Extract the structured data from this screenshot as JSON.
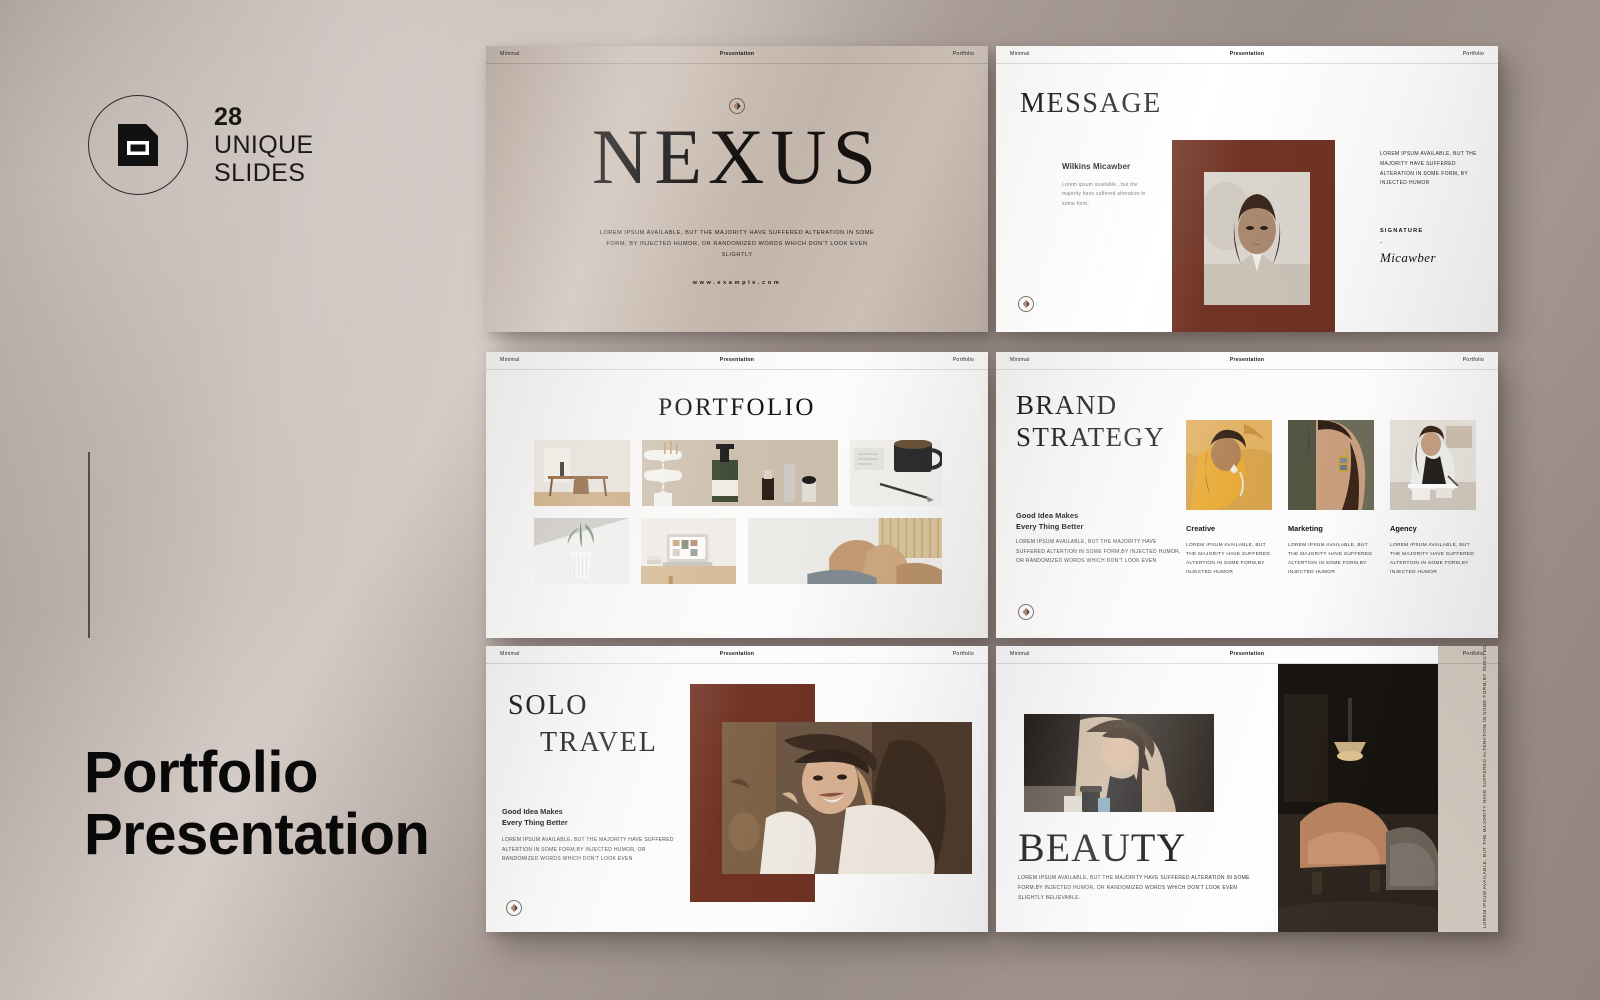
{
  "sidebar": {
    "badge": {
      "icon": "slide-icon",
      "count": "28",
      "line1": "UNIQUE",
      "line2": "SLIDES"
    },
    "main_title_line1": "Portfolio",
    "main_title_line2": "Presentation"
  },
  "colors": {
    "accent_brown": "#6e3020",
    "backdrop": "#a2968f",
    "ink": "#121010",
    "logo_copper": "#b5724a"
  },
  "slide_header": {
    "left": "Minimal",
    "center": "Presentation",
    "right": "Portfolio"
  },
  "slides": [
    {
      "id": "cover",
      "name": "nexus-cover-slide",
      "title": "NEXUS",
      "subtitle": "LOREM IPSUM AVAILABLE, BUT THE MAJORITY HAVE SUFFERED ALTERATION  IN SOME FORM, BY INJECTED HUMOR, OR RANDOMIZED WORDS WHICH DON'T LOOK EVEN SLIGHTLY",
      "url": "www.example.com"
    },
    {
      "id": "message",
      "name": "message-slide",
      "title": "MESSAGE",
      "person_name": "Wilkins Micawber",
      "person_body": "Lorem ipsum available., but the majority have suffered alteration in some form,",
      "right_body": "LOREM IPSUM AVAILABLE, BUT THE MAJORITY HAVE SUFFERED ALTERATION IN SOME FORM, BY INJECTED HUMOR",
      "signature_label": "SIGNATURE",
      "signature_dash": "-",
      "signature_name": "Micawber",
      "photo": "woman-portrait-in-brown-frame"
    },
    {
      "id": "portfolio",
      "name": "portfolio-grid-slide",
      "title": "PORTFOLIO",
      "images": [
        "dining-table-interior",
        "skincare-bottles-on-beige",
        "black-mug-and-pen-flatlay",
        "white-vase-with-plant",
        "laptop-on-wooden-desk",
        "beige-sofa-with-cushions"
      ]
    },
    {
      "id": "brand",
      "name": "brand-strategy-slide",
      "title_line1": "BRAND",
      "title_line2": "STRATEGY",
      "lead_line1": "Good Idea Makes",
      "lead_line2": "Every Thing Better",
      "body": "LOREM IPSUM AVAILABLE, BUT THE MAJORITY HAVE SUFFERED ALTERTION IN SOME FORM,BY INJECTED HUMOR, OR RANDOMIZED  WORDS WHICH DON'T LOOK EVEN",
      "columns": [
        {
          "heading": "Creative",
          "body": "LOREM IPSUM AVAILABLE, BUT THE MAJORITY HAVE SUFFERED ALTERTION  IN SOME FORM,BY INJECTED HUMOR",
          "image": "woman-with-hat-gold-jewelry"
        },
        {
          "heading": "Marketing",
          "body": "LOREM IPSUM AVAILABLE, BUT THE MAJORITY HAVE SUFFERED ALTERTION  IN SOME FORM,BY INJECTED HUMOR",
          "image": "earring-closeup-profile"
        },
        {
          "heading": "Agency",
          "body": "LOREM IPSUM AVAILABLE, BUT THE MAJORITY HAVE SUFFERED ALTERTION  IN SOME FORM,BY INJECTED HUMOR",
          "image": "woman-writing-at-desk"
        }
      ]
    },
    {
      "id": "solo",
      "name": "solo-travel-slide",
      "title_line1": "SOLO",
      "title_line2": "TRAVEL",
      "lead_line1": "Good Idea Makes",
      "lead_line2": "Every Thing Better",
      "body": "LOREM IPSUM AVAILABLE,  BUT THE MAJORITY HAVE SUFFERED ALTERTION IN SOME FORM,BY INJECTED HUMOR, OR RANDOMIZED  WORDS WHICH DON'T LOOK EVEN",
      "photo": "smiling-woman-with-hat"
    },
    {
      "id": "beauty",
      "name": "beauty-slide",
      "title": "BEAUTY",
      "body": "LOREM IPSUM AVAILABLE, BUT THE MAJORITY  HAVE SUFFERED ALTERATION IN SOME FORM,BY INJECTED HUMOR, OR RANDOMIZED  WORDS WHICH DON'T LOOK EVEN SLIGHTLY  BELIEVABLE.",
      "vertical_text": "LOREM IPSUM AVAILABLE, BUT THE MAJORITY HAVE SUFFERED ALTERATION IN SOME FORM,BY INJECTED",
      "photo1": "woman-with-coffee-cup",
      "photo2": "dark-lounge-interior"
    }
  ]
}
